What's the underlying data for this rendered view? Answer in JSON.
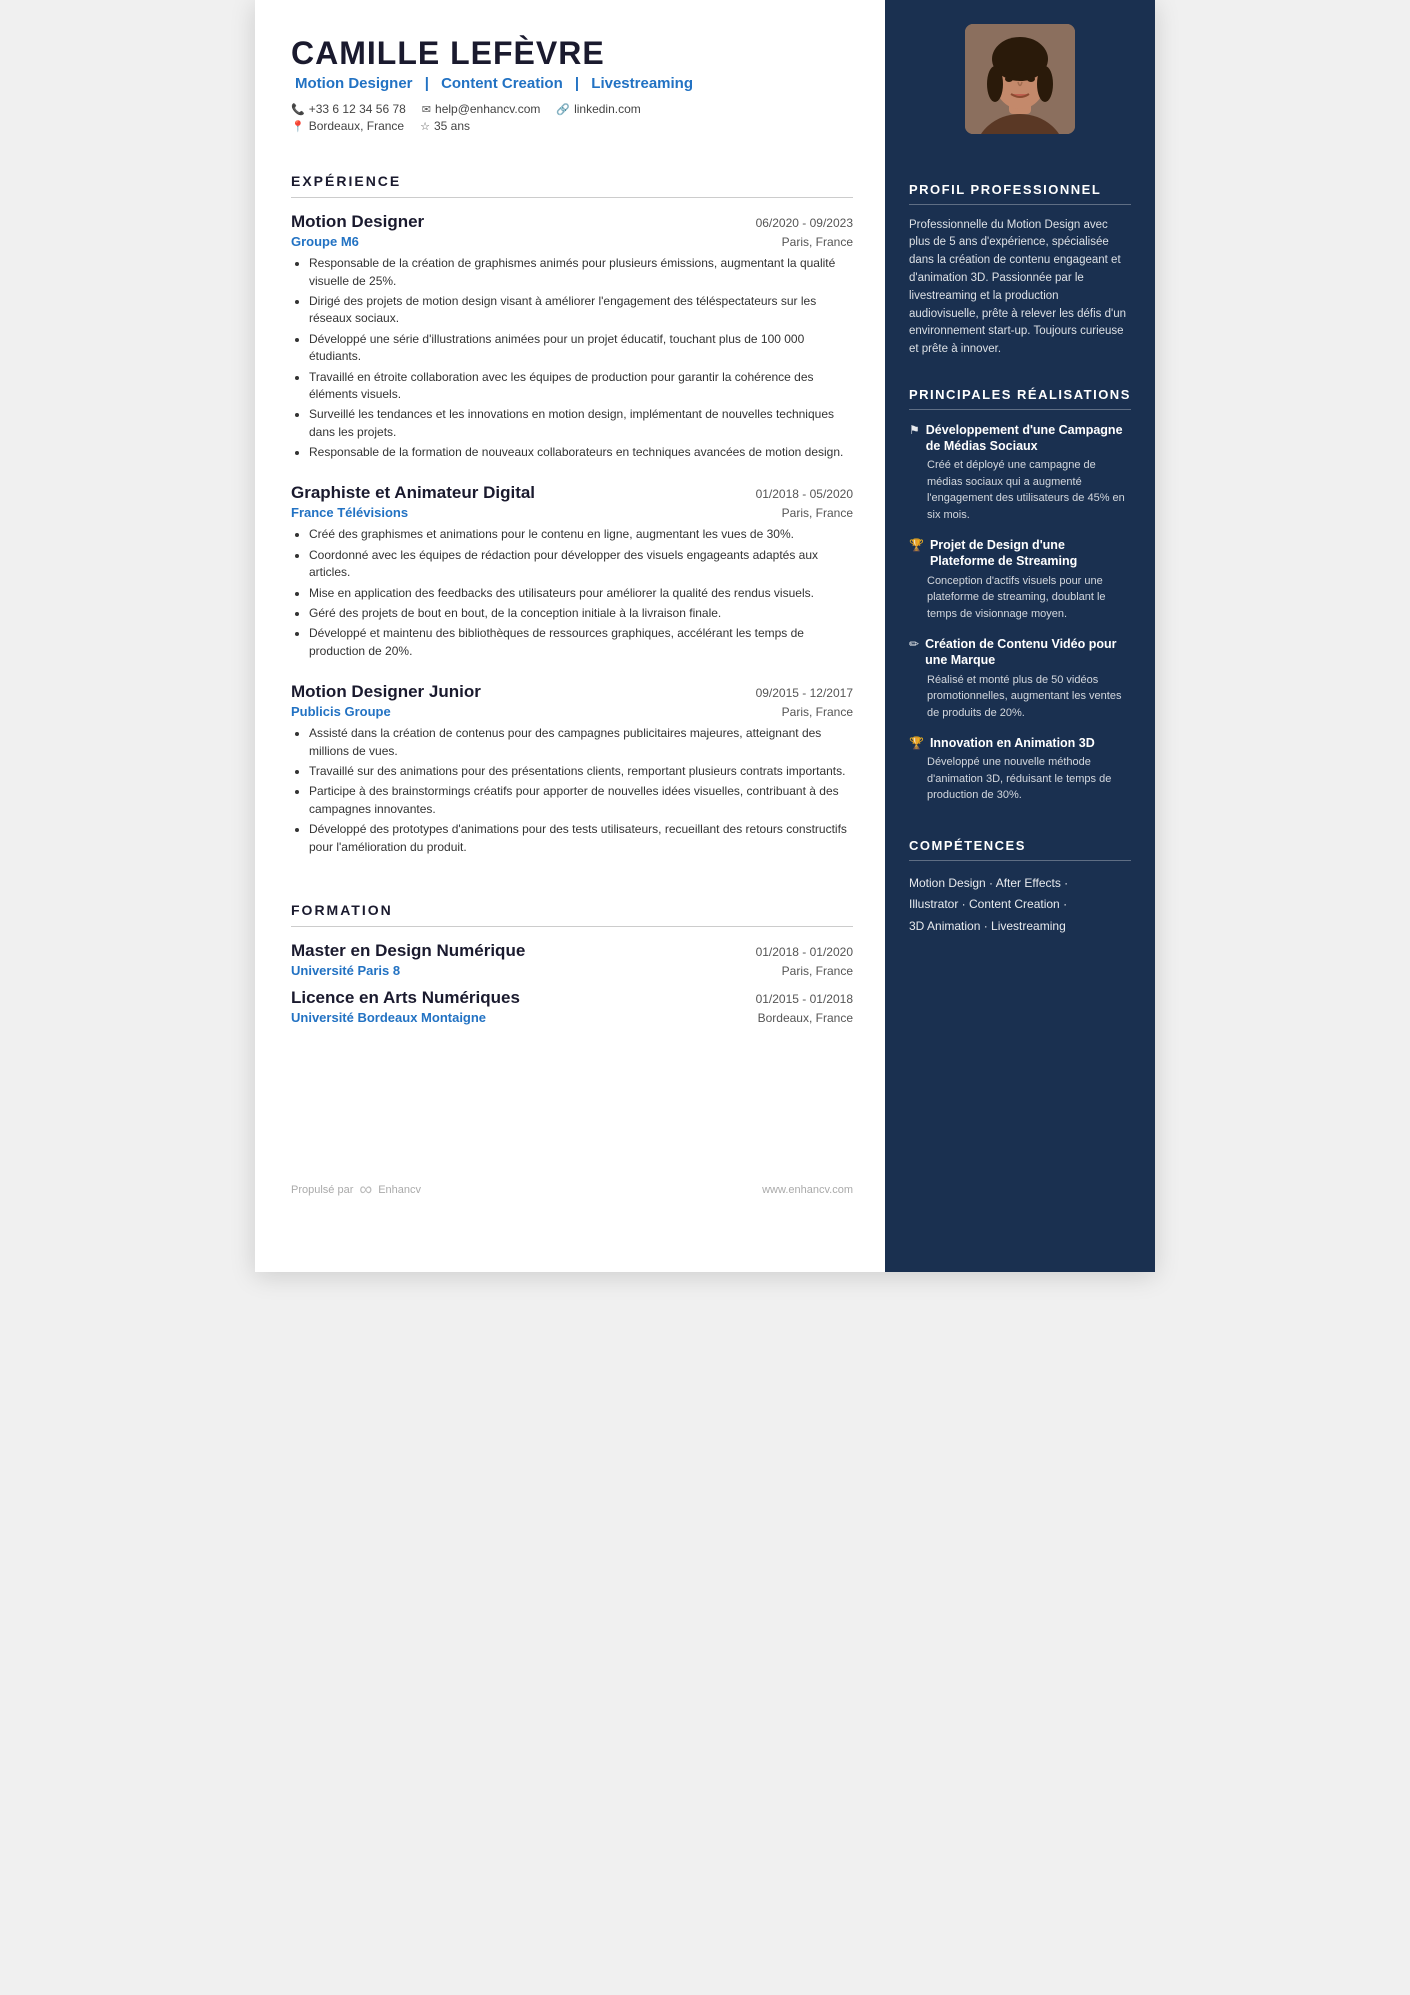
{
  "header": {
    "name": "CAMILLE LEFÈVRE",
    "subtitle": "Motion Designer | Content Creation | Livestreaming",
    "subtitle_parts": [
      "Motion Designer",
      "Content Creation",
      "Livestreaming"
    ],
    "phone": "+33 6 12 34 56 78",
    "email": "help@enhancv.com",
    "linkedin": "linkedin.com",
    "location": "Bordeaux, France",
    "age": "35 ans"
  },
  "sections": {
    "experience_title": "EXPÉRIENCE",
    "formation_title": "FORMATION"
  },
  "experiences": [
    {
      "title": "Motion Designer",
      "dates": "06/2020 - 09/2023",
      "company": "Groupe M6",
      "location": "Paris, France",
      "bullets": [
        "Responsable de la création de graphismes animés pour plusieurs émissions, augmentant la qualité visuelle de 25%.",
        "Dirigé des projets de motion design visant à améliorer l'engagement des téléspectateurs sur les réseaux sociaux.",
        "Développé une série d'illustrations animées pour un projet éducatif, touchant plus de 100 000 étudiants.",
        "Travaillé en étroite collaboration avec les équipes de production pour garantir la cohérence des éléments visuels.",
        "Surveillé les tendances et les innovations en motion design, implémentant de nouvelles techniques dans les projets.",
        "Responsable de la formation de nouveaux collaborateurs en techniques avancées de motion design."
      ]
    },
    {
      "title": "Graphiste et Animateur Digital",
      "dates": "01/2018 - 05/2020",
      "company": "France Télévisions",
      "location": "Paris, France",
      "bullets": [
        "Créé des graphismes et animations pour le contenu en ligne, augmentant les vues de 30%.",
        "Coordonné avec les équipes de rédaction pour développer des visuels engageants adaptés aux articles.",
        "Mise en application des feedbacks des utilisateurs pour améliorer la qualité des rendus visuels.",
        "Géré des projets de bout en bout, de la conception initiale à la livraison finale.",
        "Développé et maintenu des bibliothèques de ressources graphiques, accélérant les temps de production de 20%."
      ]
    },
    {
      "title": "Motion Designer Junior",
      "dates": "09/2015 - 12/2017",
      "company": "Publicis Groupe",
      "location": "Paris, France",
      "bullets": [
        "Assisté dans la création de contenus pour des campagnes publicitaires majeures, atteignant des millions de vues.",
        "Travaillé sur des animations pour des présentations clients, remportant plusieurs contrats importants.",
        "Participe à des brainstormings créatifs pour apporter de nouvelles idées visuelles, contribuant à des campagnes innovantes.",
        "Développé des prototypes d'animations pour des tests utilisateurs, recueillant des retours constructifs pour l'amélioration du produit."
      ]
    }
  ],
  "education": [
    {
      "title": "Master en Design Numérique",
      "dates": "01/2018 - 01/2020",
      "school": "Université Paris 8",
      "location": "Paris, France"
    },
    {
      "title": "Licence en Arts Numériques",
      "dates": "01/2015 - 01/2018",
      "school": "Université Bordeaux Montaigne",
      "location": "Bordeaux, France"
    }
  ],
  "right": {
    "profil_title": "PROFIL PROFESSIONNEL",
    "profil_text": "Professionnelle du Motion Design avec plus de 5 ans d'expérience, spécialisée dans la création de contenu engageant et d'animation 3D. Passionnée par le livestreaming et la production audiovisuelle, prête à relever les défis d'un environnement start-up. Toujours curieuse et prête à innover.",
    "realisations_title": "PRINCIPALES RÉALISATIONS",
    "realisations": [
      {
        "icon": "🏳",
        "title": "Développement d'une Campagne de Médias Sociaux",
        "desc": "Créé et déployé une campagne de médias sociaux qui a augmenté l'engagement des utilisateurs de 45% en six mois."
      },
      {
        "icon": "🏆",
        "title": "Projet de Design d'une Plateforme de Streaming",
        "desc": "Conception d'actifs visuels pour une plateforme de streaming, doublant le temps de visionnage moyen."
      },
      {
        "icon": "✏",
        "title": "Création de Contenu Vidéo pour une Marque",
        "desc": "Réalisé et monté plus de 50 vidéos promotionnelles, augmentant les ventes de produits de 20%."
      },
      {
        "icon": "🏆",
        "title": "Innovation en Animation 3D",
        "desc": "Développé une nouvelle méthode d'animation 3D, réduisant le temps de production de 30%."
      }
    ],
    "competences_title": "COMPÉTENCES",
    "competences_lines": [
      "Motion Design · After Effects ·",
      "Illustrator · Content Creation ·",
      "3D Animation · Livestreaming"
    ]
  },
  "footer": {
    "powered_by": "Propulsé par",
    "brand": "Enhancv",
    "website": "www.enhancv.com"
  }
}
